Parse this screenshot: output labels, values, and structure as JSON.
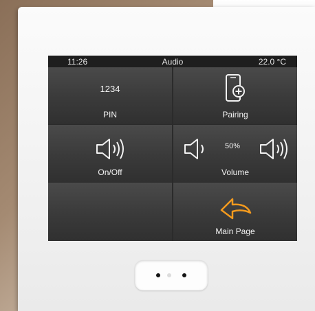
{
  "status_bar": {
    "time": "11:26",
    "title": "Audio",
    "temperature": "22.0 °C"
  },
  "tiles": {
    "pin": {
      "value": "1234",
      "label": "PIN"
    },
    "pairing": {
      "label": "Pairing",
      "icon": "phone-add-icon"
    },
    "onoff": {
      "label": "On/Off",
      "icon": "speaker-icon"
    },
    "volume": {
      "label": "Volume",
      "value": "50%",
      "down_icon": "speaker-low-icon",
      "up_icon": "speaker-high-icon"
    },
    "main_page": {
      "label": "Main Page",
      "icon": "back-arrow-icon"
    }
  },
  "colors": {
    "accent": "#f39a1e",
    "tile": "#3d3d3d",
    "status_bar": "#1e1e1e"
  }
}
